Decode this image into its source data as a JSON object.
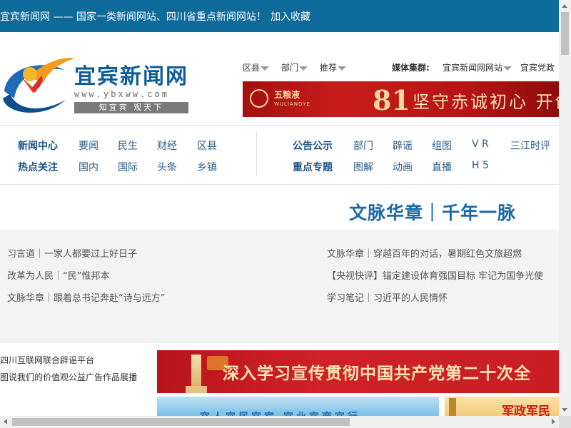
{
  "topbar": {
    "slogan": "宜宾新闻网 —— 国家一类新闻网站、四川省重点新闻网站！",
    "favorite": "加入收藏"
  },
  "logo": {
    "name": "宜宾新闻网",
    "domain": "www.ybxww.com",
    "motto": "知宜宾  观天下",
    "icon": "ybxww-swoosh-logo"
  },
  "header_menu": {
    "items": [
      "区县",
      "部门",
      "推荐"
    ],
    "media_label": "媒体集群:",
    "media_items": [
      "宜宾新闻网网站",
      "宜宾党政"
    ]
  },
  "banner": {
    "brand_cn": "五粮液",
    "brand_en": "WULIANGYE",
    "number": "81",
    "slogan": "坚守赤诚初心 开创"
  },
  "nav": {
    "row1_head": "新闻中心",
    "row1_items": [
      "要闻",
      "民生",
      "财经",
      "区县"
    ],
    "row2_head": "热点关注",
    "row2_items": [
      "国内",
      "国际",
      "头条",
      "乡镇"
    ],
    "row1r_head": "公告公示",
    "row1r_items": [
      "部门",
      "辟谣",
      "组图",
      "V R",
      "三江时评"
    ],
    "row2r_head": "重点专题",
    "row2r_items": [
      "图解",
      "动画",
      "直播",
      "H 5"
    ]
  },
  "feature": {
    "headline": "文脉华章｜千年一脉"
  },
  "news": {
    "left": [
      "习言道｜一家人都要过上好日子",
      "改革为人民｜“民”惟邦本",
      "文脉华章｜跟着总书记奔赴“诗与远方”"
    ],
    "right": [
      "文脉华章｜穿越百年的对话，暑期红色文旅超燃",
      "【央视快评】锚定建设体育强国目标 牢记为国争光使",
      "学习笔记｜习近平的人民情怀"
    ]
  },
  "bottom": {
    "side_links": [
      "四川互联网联合辟谣平台",
      "图说我们的价值观公益广告作品展播"
    ],
    "big_banner": "深入学习宣传贯彻中国共产党第二十次全",
    "small_banner": "宜人宜居宜宾  宜业宜商宜行",
    "small_banner2": "军政军民"
  },
  "colors": {
    "topbar": "#0d6a9b",
    "nav_head": "#1b5487",
    "feature": "#1a6aa7",
    "banner_red": "#c61d1b"
  }
}
